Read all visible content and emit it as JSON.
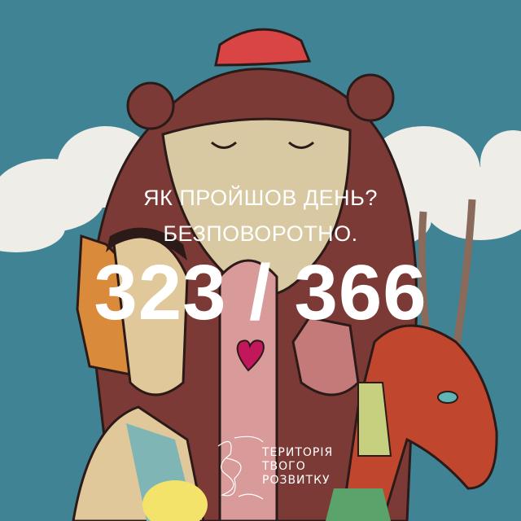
{
  "caption": {
    "question": "ЯК ПРОЙШОВ ДЕНЬ?",
    "answer": "БЕЗПОВОРОТНО.",
    "counter": "323 / 366"
  },
  "logo": {
    "line1": "ТЕРИТОРІЯ",
    "line2": "ТВОГО",
    "line3": "РОЗВИТКУ"
  },
  "colors": {
    "sky": "#3f8394",
    "cloud": "#efeeea",
    "bear": "#7b3a36",
    "bear_face": "#d8c9a2",
    "text": "#ffffff"
  }
}
